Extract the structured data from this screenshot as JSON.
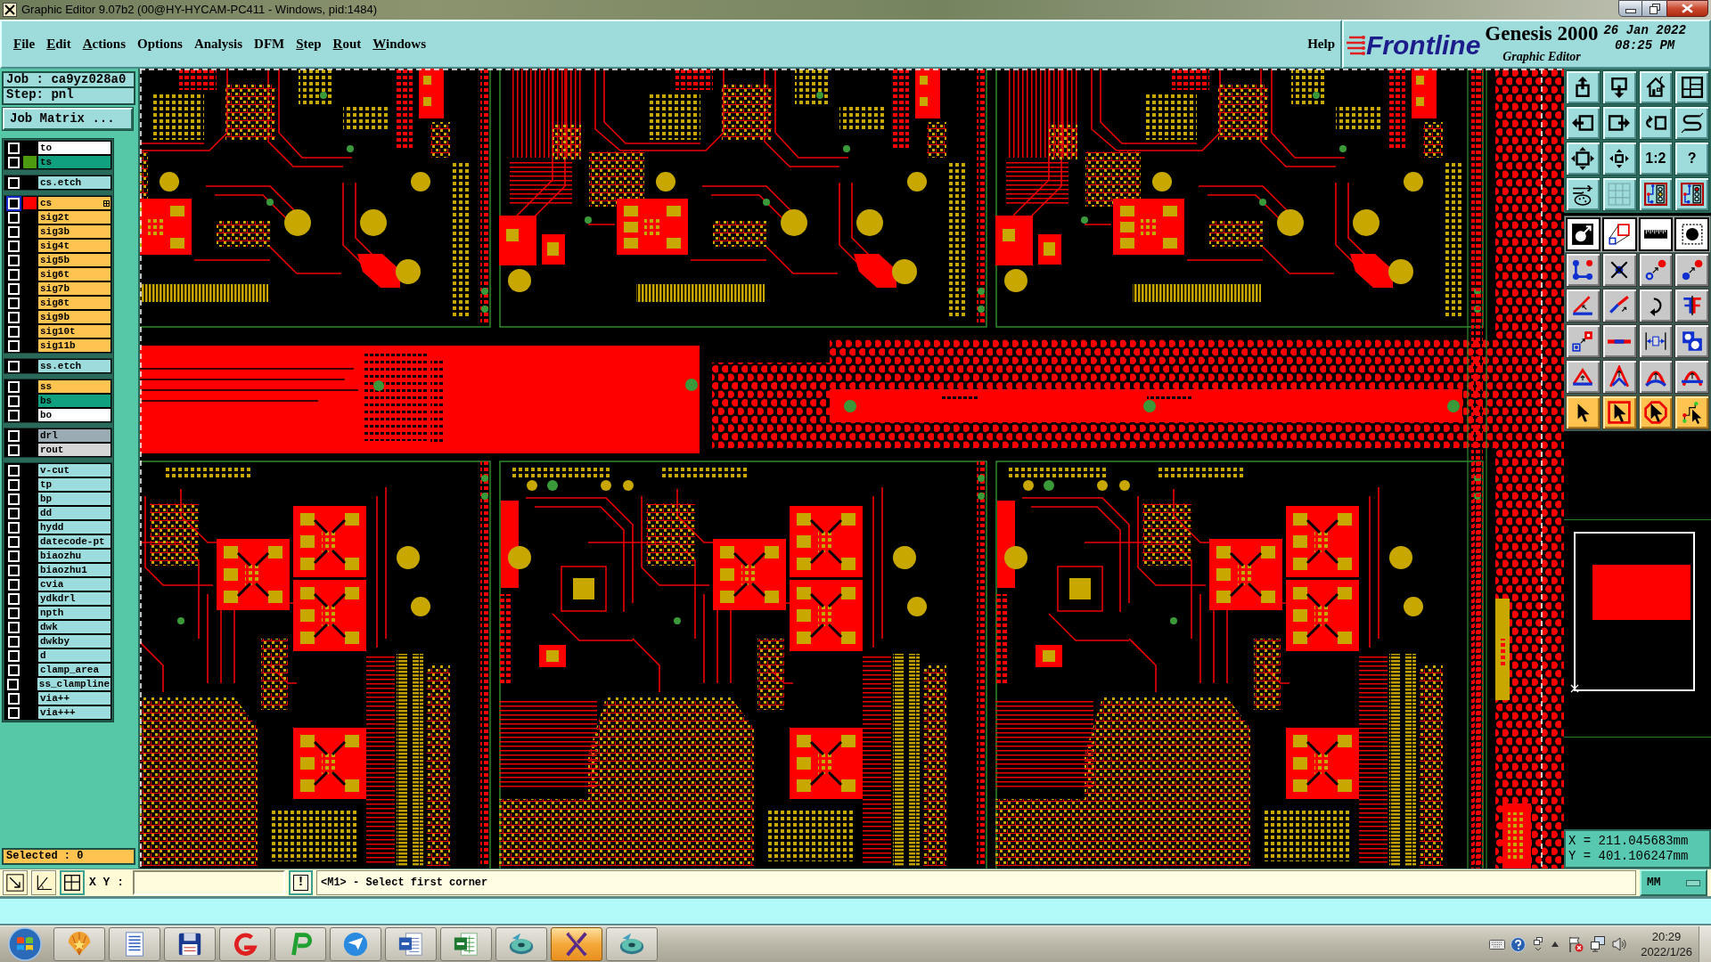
{
  "window": {
    "title": "Graphic Editor 9.07b2 (00@HY-HYCAM-PC411 - Windows, pid:1484)"
  },
  "menu": [
    {
      "label": "File",
      "mnemonic": true
    },
    {
      "label": "Edit",
      "mnemonic": true
    },
    {
      "label": "Actions",
      "mnemonic": true
    },
    {
      "label": "Options",
      "mnemonic": false
    },
    {
      "label": "Analysis",
      "mnemonic": false
    },
    {
      "label": "DFM",
      "mnemonic": false
    },
    {
      "label": "Step",
      "mnemonic": true
    },
    {
      "label": "Rout",
      "mnemonic": true
    },
    {
      "label": "Windows",
      "mnemonic": true
    }
  ],
  "help_menu": {
    "label": "Help",
    "mnemonic": false
  },
  "header": {
    "logo": "Frontline",
    "product": "Genesis 2000",
    "subtitle": "Graphic Editor",
    "date": "26 Jan 2022",
    "time": "08:25 PM"
  },
  "job_panel": {
    "job": "Job : ca9yz028a0",
    "step": "Step: pnl",
    "matrix_button": "Job Matrix ..."
  },
  "layer_groups": [
    {
      "layers": [
        {
          "name": "to",
          "color": "#ffffff",
          "checked": false,
          "selected": false
        },
        {
          "name": "ts",
          "color": "#10a080",
          "swatch": {
            "color": "#4c9a10"
          },
          "checked": false,
          "selected": false
        }
      ]
    },
    {
      "layers": [
        {
          "name": "cs.etch",
          "color": "#9cdcdc",
          "checked": false,
          "selected": false
        }
      ]
    },
    {
      "layers": [
        {
          "name": "cs",
          "color": "#ffc34f",
          "swatch": {
            "color": "#ff0000"
          },
          "checked": false,
          "selected": true
        },
        {
          "name": "sig2t",
          "color": "#ffc34f",
          "checked": false,
          "selected": false
        },
        {
          "name": "sig3b",
          "color": "#ffc34f",
          "checked": false,
          "selected": false
        },
        {
          "name": "sig4t",
          "color": "#ffc34f",
          "checked": false,
          "selected": false
        },
        {
          "name": "sig5b",
          "color": "#ffc34f",
          "checked": false,
          "selected": false
        },
        {
          "name": "sig6t",
          "color": "#ffc34f",
          "checked": false,
          "selected": false
        },
        {
          "name": "sig7b",
          "color": "#ffc34f",
          "checked": false,
          "selected": false
        },
        {
          "name": "sig8t",
          "color": "#ffc34f",
          "checked": false,
          "selected": false
        },
        {
          "name": "sig9b",
          "color": "#ffc34f",
          "checked": false,
          "selected": false
        },
        {
          "name": "sig10t",
          "color": "#ffc34f",
          "checked": false,
          "selected": false
        },
        {
          "name": "sig11b",
          "color": "#ffc34f",
          "checked": false,
          "selected": false
        }
      ]
    },
    {
      "layers": [
        {
          "name": "ss.etch",
          "color": "#9cdcdc",
          "checked": false,
          "selected": false
        }
      ]
    },
    {
      "layers": [
        {
          "name": "ss",
          "color": "#ffc34f",
          "checked": false,
          "selected": false
        },
        {
          "name": "bs",
          "color": "#10a080",
          "checked": false,
          "selected": false
        },
        {
          "name": "bo",
          "color": "#ffffff",
          "checked": false,
          "selected": false
        }
      ]
    },
    {
      "layers": [
        {
          "name": "drl",
          "color": "#9aabb4",
          "checked": false,
          "selected": false
        },
        {
          "name": "rout",
          "color": "#d6d6d6",
          "checked": false,
          "selected": false
        }
      ]
    },
    {
      "layers": [
        {
          "name": "v-cut",
          "color": "#9cdcdc",
          "checked": false,
          "selected": false
        },
        {
          "name": "tp",
          "color": "#9cdcdc",
          "checked": false,
          "selected": false
        },
        {
          "name": "bp",
          "color": "#9cdcdc",
          "checked": false,
          "selected": false
        },
        {
          "name": "dd",
          "color": "#9cdcdc",
          "checked": false,
          "selected": false
        },
        {
          "name": "hydd",
          "color": "#9cdcdc",
          "checked": false,
          "selected": false
        },
        {
          "name": "datecode-pt",
          "color": "#9cdcdc",
          "checked": false,
          "selected": false
        },
        {
          "name": "biaozhu",
          "color": "#9cdcdc",
          "checked": false,
          "selected": false
        },
        {
          "name": "biaozhu1",
          "color": "#9cdcdc",
          "checked": false,
          "selected": false
        },
        {
          "name": "cvia",
          "color": "#9cdcdc",
          "checked": false,
          "selected": false
        },
        {
          "name": "ydkdrl",
          "color": "#9cdcdc",
          "checked": false,
          "selected": false
        },
        {
          "name": "npth",
          "color": "#9cdcdc",
          "checked": false,
          "selected": false
        },
        {
          "name": "dwk",
          "color": "#9cdcdc",
          "checked": false,
          "selected": false
        },
        {
          "name": "dwkby",
          "color": "#9cdcdc",
          "checked": false,
          "selected": false
        },
        {
          "name": "d",
          "color": "#9cdcdc",
          "checked": false,
          "selected": false
        },
        {
          "name": "clamp_area",
          "color": "#9cdcdc",
          "checked": false,
          "selected": false
        },
        {
          "name": "ss_clampline",
          "color": "#9cdcdc",
          "checked": false,
          "selected": false
        },
        {
          "name": "via++",
          "color": "#9cdcdc",
          "checked": false,
          "selected": false
        },
        {
          "name": "via+++",
          "color": "#9cdcdc",
          "checked": false,
          "selected": false
        }
      ]
    }
  ],
  "selected_count": "Selected : 0",
  "toolbar": [
    {
      "kind": "view"
    },
    {
      "kind": "view"
    },
    {
      "kind": "view"
    },
    {
      "kind": "view"
    },
    {
      "kind": "view"
    },
    {
      "kind": "view"
    },
    {
      "kind": "view"
    },
    {
      "kind": "view"
    },
    {
      "kind": "view"
    },
    {
      "kind": "view"
    },
    {
      "kind": "view",
      "label": "1:2"
    },
    {
      "kind": "view",
      "label": "?"
    },
    {
      "kind": "view"
    },
    {
      "kind": "view"
    },
    {
      "kind": "view"
    },
    {
      "kind": "view"
    },
    {
      "kind": "display"
    },
    {
      "kind": "display"
    },
    {
      "kind": "display"
    },
    {
      "kind": "display"
    },
    {
      "kind": "edit"
    },
    {
      "kind": "edit"
    },
    {
      "kind": "edit"
    },
    {
      "kind": "edit"
    },
    {
      "kind": "edit"
    },
    {
      "kind": "edit"
    },
    {
      "kind": "edit"
    },
    {
      "kind": "edit"
    },
    {
      "kind": "edit"
    },
    {
      "kind": "edit"
    },
    {
      "kind": "edit"
    },
    {
      "kind": "edit"
    },
    {
      "kind": "edit"
    },
    {
      "kind": "edit"
    },
    {
      "kind": "edit"
    },
    {
      "kind": "edit"
    },
    {
      "kind": "select"
    },
    {
      "kind": "select"
    },
    {
      "kind": "select"
    },
    {
      "kind": "select"
    }
  ],
  "cursor_readout": {
    "x": "X = 211.045683mm",
    "y": "Y = 401.106247mm"
  },
  "command_line": {
    "tools": [
      {
        "selected": false
      },
      {
        "selected": false
      },
      {
        "selected": true
      }
    ],
    "label": "X Y :",
    "alert_button": "!",
    "prompt": "<M1> - Select first corner",
    "units": "MM"
  },
  "taskbar": {
    "apps": [
      {
        "selected": false
      },
      {
        "selected": false
      },
      {
        "selected": false
      },
      {
        "selected": false
      },
      {
        "selected": false
      },
      {
        "selected": false
      },
      {
        "selected": false
      },
      {
        "selected": false
      },
      {
        "selected": false
      },
      {
        "selected": true
      },
      {
        "selected": false
      }
    ],
    "time": "20:29",
    "date": "2022/1/26"
  }
}
